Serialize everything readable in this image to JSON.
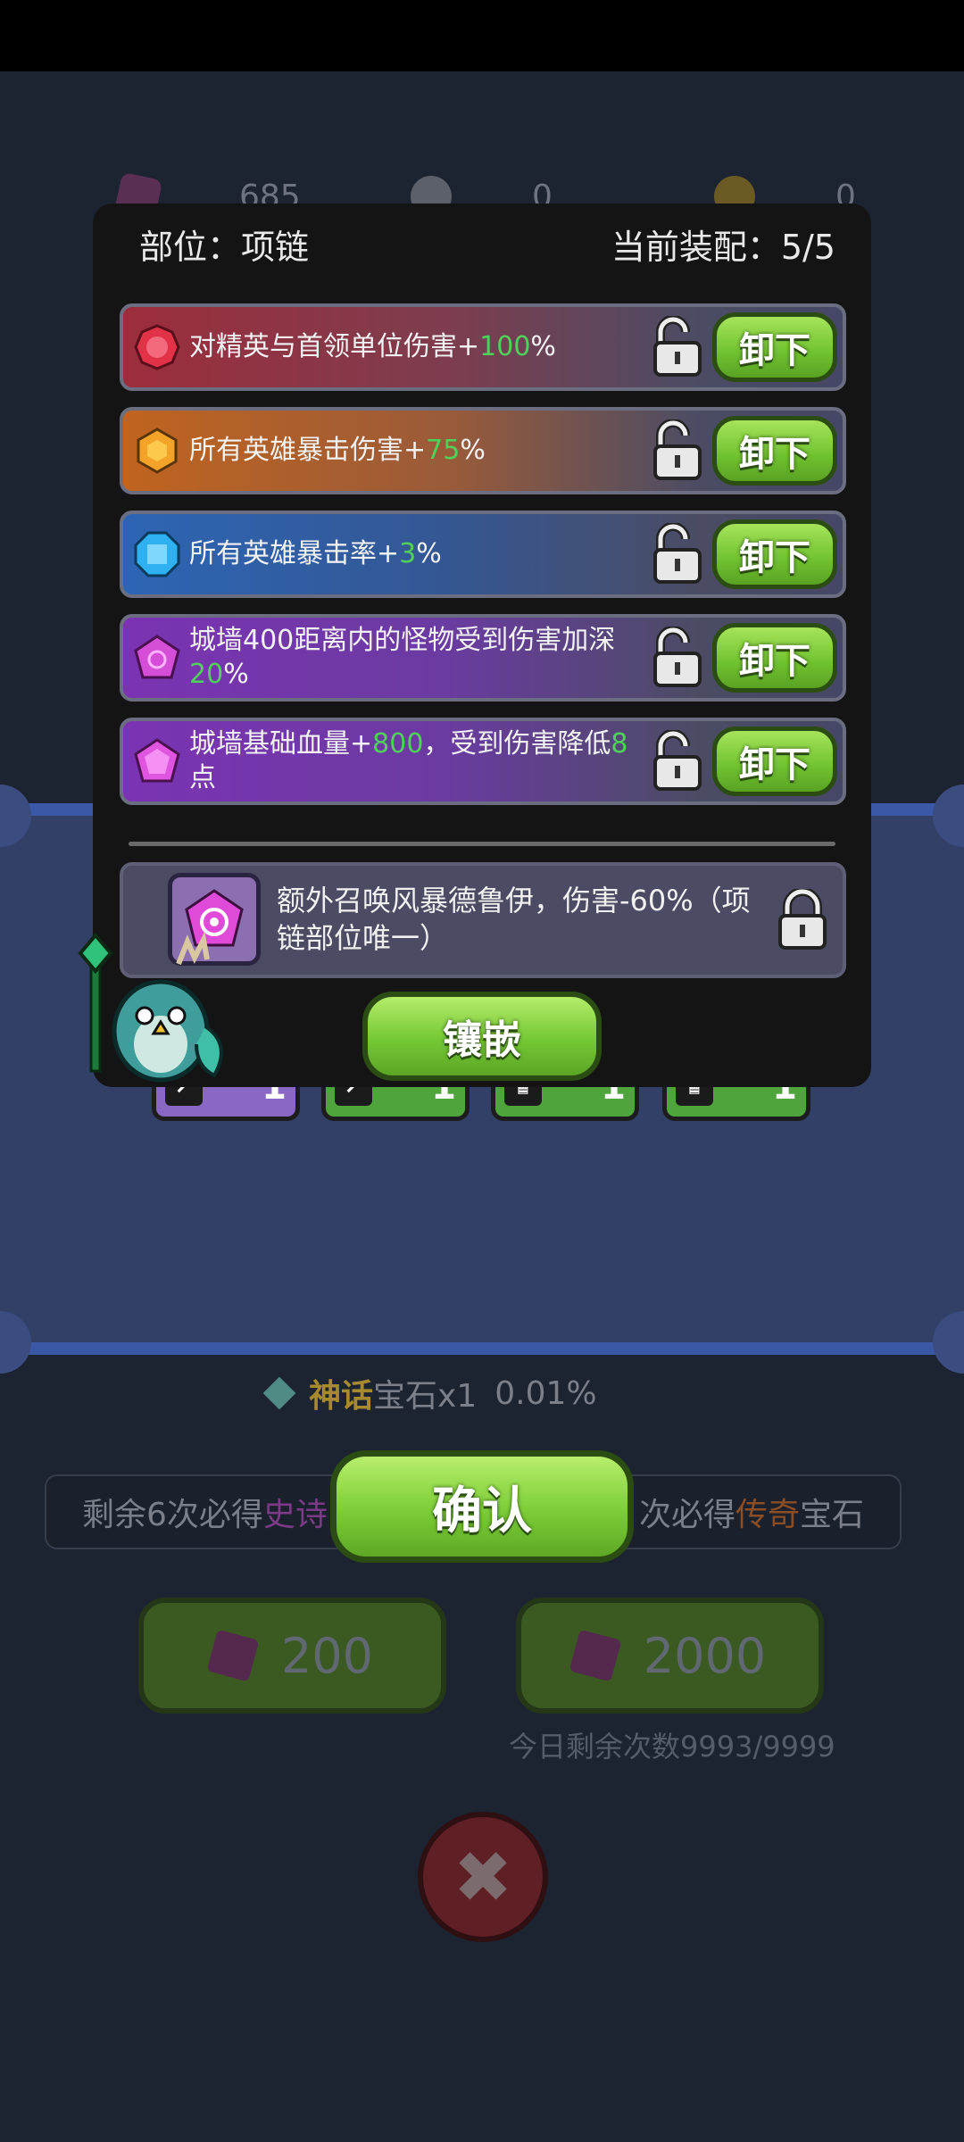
{
  "currencies": [
    {
      "name": "gem",
      "value": "685"
    },
    {
      "name": "silver-key",
      "value": "0"
    },
    {
      "name": "gold-key",
      "value": "0"
    }
  ],
  "background": {
    "rate_rarity": "神话",
    "rate_item": "宝石x1",
    "rate_value": "0.01%",
    "pity_left": "剩余6次必得",
    "pity_left_rarity": "史诗",
    "pity_right": "次必得",
    "pity_right_rarity": "传奇",
    "pity_right_suffix": "宝石",
    "draw_one_cost": "200",
    "draw_ten_cost": "2000",
    "remaining_today": "今日剩余次数9993/9999",
    "close_symbol": "✖"
  },
  "modal": {
    "slot_label": "部位：项链",
    "equipped_label": "当前装配：5/5",
    "unload_label": "卸下",
    "gems": [
      {
        "color": "#e0304a",
        "text_pre": "对精英与首领单位伤害+",
        "value": "100",
        "text_post": "%"
      },
      {
        "color": "#f3a428",
        "text_pre": "所有英雄暴击伤害+",
        "value": "75",
        "text_post": "%"
      },
      {
        "color": "#2fb0f0",
        "text_pre": "所有英雄暴击率+",
        "value": "3",
        "text_post": "%"
      },
      {
        "color": "#d54ed8",
        "text_pre": "城墙400距离内的怪物受到伤害加深",
        "value": "20",
        "text_post": "%"
      },
      {
        "color": "#e055e0",
        "text_pre": "城墙基础血量+",
        "value": "800",
        "text_mid": "，受到伤害降低",
        "value2": "8",
        "text_post": "点"
      }
    ],
    "special_text": "额外召唤风暴德鲁伊，伤害-60%（项链部位唯一）",
    "inlay_label": "镶嵌"
  },
  "hero_slots": [
    {
      "count": "1",
      "color": "purple"
    },
    {
      "count": "1",
      "color": "green"
    },
    {
      "count": "1",
      "color": "green"
    },
    {
      "count": "1",
      "color": "green"
    }
  ],
  "confirm_label": "确认"
}
